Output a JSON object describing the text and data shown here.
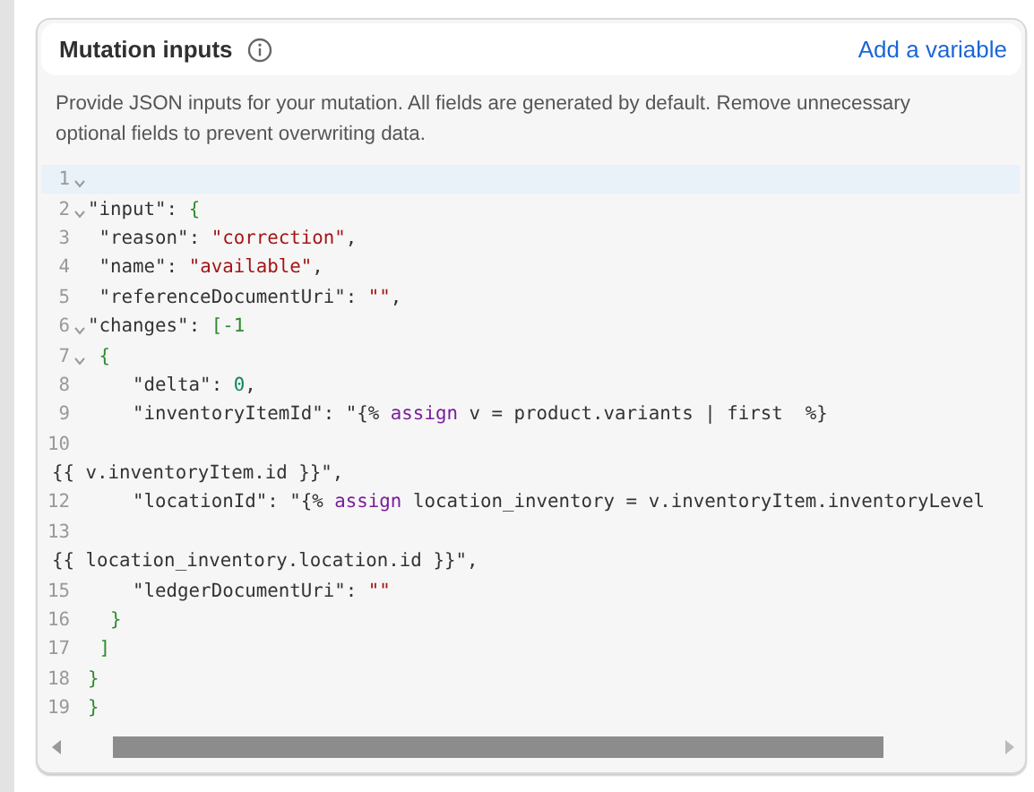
{
  "panel": {
    "title": "Mutation inputs",
    "link": "Add a variable",
    "description": "Provide JSON inputs for your mutation. All fields are generated by default. Remove unnecessary optional fields to prevent overwriting data."
  },
  "editor": {
    "lines": [
      {
        "number": "1",
        "fold": true,
        "active": true
      },
      {
        "number": "2",
        "fold": true,
        "active": false,
        "tokens": [
          {
            "kind": "key",
            "text": "\"input\""
          },
          {
            "kind": "punct",
            "text": ": "
          },
          {
            "kind": "bracket",
            "text": "{"
          }
        ]
      },
      {
        "number": "3",
        "fold": false,
        "active": false,
        "tokens": [
          {
            "kind": "key",
            "text": " \"reason\""
          },
          {
            "kind": "punct",
            "text": ": "
          },
          {
            "kind": "string",
            "text": "\"correction\""
          },
          {
            "kind": "punct",
            "text": ","
          }
        ]
      },
      {
        "number": "4",
        "fold": false,
        "active": false,
        "tokens": [
          {
            "kind": "key",
            "text": " \"name\""
          },
          {
            "kind": "punct",
            "text": ": "
          },
          {
            "kind": "string",
            "text": "\"available\""
          },
          {
            "kind": "punct",
            "text": ","
          }
        ]
      },
      {
        "number": "5",
        "fold": false,
        "active": false,
        "tokens": [
          {
            "kind": "key",
            "text": " \"referenceDocumentUri\""
          },
          {
            "kind": "punct",
            "text": ": "
          },
          {
            "kind": "string",
            "text": "\"\""
          },
          {
            "kind": "punct",
            "text": ","
          }
        ]
      },
      {
        "number": "6",
        "fold": true,
        "active": false,
        "tokens": [
          {
            "kind": "key",
            "text": "\"changes\""
          },
          {
            "kind": "punct",
            "text": ": "
          },
          {
            "kind": "bracket",
            "text": "[-1"
          }
        ]
      },
      {
        "number": "7",
        "fold": true,
        "active": false,
        "tokens": [
          {
            "kind": "bracket",
            "text": " {"
          }
        ]
      },
      {
        "number": "8",
        "fold": false,
        "active": false,
        "tokens": [
          {
            "kind": "key",
            "text": "    \"delta\""
          },
          {
            "kind": "punct",
            "text": ": "
          },
          {
            "kind": "number",
            "text": "0"
          },
          {
            "kind": "punct",
            "text": ","
          }
        ]
      },
      {
        "number": "9",
        "fold": false,
        "active": false,
        "tokens": [
          {
            "kind": "key",
            "text": "    \"inventoryItemId\""
          },
          {
            "kind": "punct",
            "text": ": \"{% "
          },
          {
            "kind": "keyword",
            "text": "assign"
          },
          {
            "kind": "punct",
            "text": " v = product.variants | first  %}"
          }
        ]
      },
      {
        "number": "10",
        "fold": false,
        "active": false
      },
      {
        "active": false,
        "tokens": [
          {
            "kind": "punct",
            "text": "{{ v.inventoryItem.id }}\","
          }
        ]
      },
      {
        "number": "12",
        "fold": false,
        "active": false,
        "tokens": [
          {
            "kind": "key",
            "text": "    \"locationId\""
          },
          {
            "kind": "punct",
            "text": ": \"{% "
          },
          {
            "kind": "keyword",
            "text": "assign"
          },
          {
            "kind": "punct",
            "text": " location_inventory = v.inventoryItem.inventoryLevel"
          }
        ]
      },
      {
        "number": "13",
        "fold": false,
        "active": false
      },
      {
        "active": false,
        "tokens": [
          {
            "kind": "punct",
            "text": "{{ location_inventory.location.id }}\","
          }
        ]
      },
      {
        "number": "15",
        "fold": false,
        "active": false,
        "tokens": [
          {
            "kind": "key",
            "text": "    \"ledgerDocumentUri\""
          },
          {
            "kind": "punct",
            "text": ": "
          },
          {
            "kind": "string",
            "text": "\"\""
          }
        ]
      },
      {
        "number": "16",
        "fold": false,
        "active": false,
        "tokens": [
          {
            "kind": "bracket",
            "text": "  }"
          }
        ]
      },
      {
        "number": "17",
        "fold": false,
        "active": false,
        "tokens": [
          {
            "kind": "bracket",
            "text": " ]"
          }
        ]
      },
      {
        "number": "18",
        "fold": false,
        "active": false,
        "tokens": [
          {
            "kind": "bracket",
            "text": "}"
          }
        ]
      },
      {
        "number": "19",
        "fold": false,
        "active": false,
        "tokens": [
          {
            "kind": "bracket",
            "text": "}"
          }
        ]
      }
    ]
  }
}
